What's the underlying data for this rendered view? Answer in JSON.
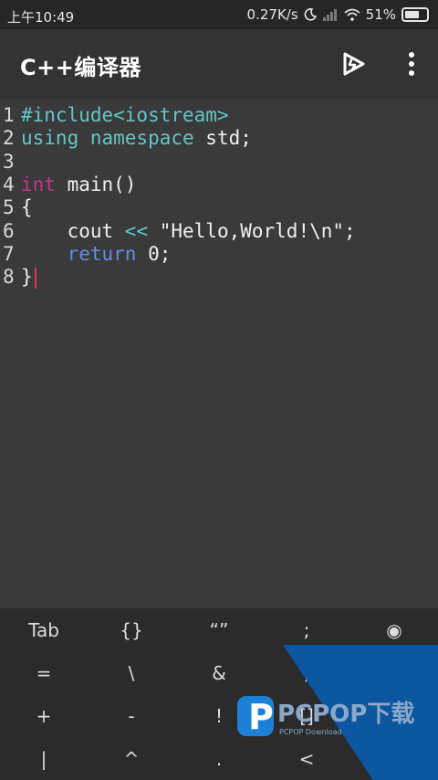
{
  "status_bar": {
    "time": "上午10:49",
    "speed": "0.27K/s",
    "battery_percent": "51%",
    "icons": [
      "moon-icon",
      "signal-icon",
      "wifi-icon",
      "battery-icon"
    ]
  },
  "app_bar": {
    "title": "C++编译器",
    "actions": [
      "run-icon",
      "more-vert-icon"
    ]
  },
  "editor": {
    "lines": [
      {
        "num": "1",
        "segments": [
          {
            "t": "#include<iostream>",
            "c": "pre"
          }
        ]
      },
      {
        "num": "2",
        "segments": [
          {
            "t": "using namespace",
            "c": "pre"
          },
          {
            "t": " std;",
            "c": "code"
          }
        ]
      },
      {
        "num": "3",
        "segments": []
      },
      {
        "num": "4",
        "segments": [
          {
            "t": "int",
            "c": "type"
          },
          {
            "t": " main()",
            "c": "code"
          }
        ]
      },
      {
        "num": "5",
        "segments": [
          {
            "t": "{",
            "c": "code"
          }
        ]
      },
      {
        "num": "6",
        "segments": [
          {
            "t": "    cout ",
            "c": "code"
          },
          {
            "t": "<<",
            "c": "op"
          },
          {
            "t": " \"Hello,World!\\n\";",
            "c": "code"
          }
        ]
      },
      {
        "num": "7",
        "segments": [
          {
            "t": "    ",
            "c": "code"
          },
          {
            "t": "return",
            "c": "kw"
          },
          {
            "t": " 0;",
            "c": "code"
          }
        ]
      },
      {
        "num": "8",
        "segments": [
          {
            "t": "}",
            "c": "code"
          }
        ]
      }
    ]
  },
  "keyboard": {
    "rows": [
      [
        "Tab",
        "{}",
        "“”",
        ";",
        "◉"
      ],
      [
        "=",
        "\\",
        "&",
        ",",
        ""
      ],
      [
        "+",
        "-",
        "!",
        "[]",
        ""
      ],
      [
        "|",
        "^",
        ".",
        "<",
        ""
      ]
    ]
  },
  "watermark": {
    "brand": "PCPOP下载",
    "sub": "PCPOP Download"
  },
  "colors": {
    "background": "#3a3a3a",
    "preprocessor": "#63c6c6",
    "keyword": "#5e8ee8",
    "type": "#c0398a",
    "cursor": "#e0305a",
    "watermark": "#0b5aa6"
  }
}
